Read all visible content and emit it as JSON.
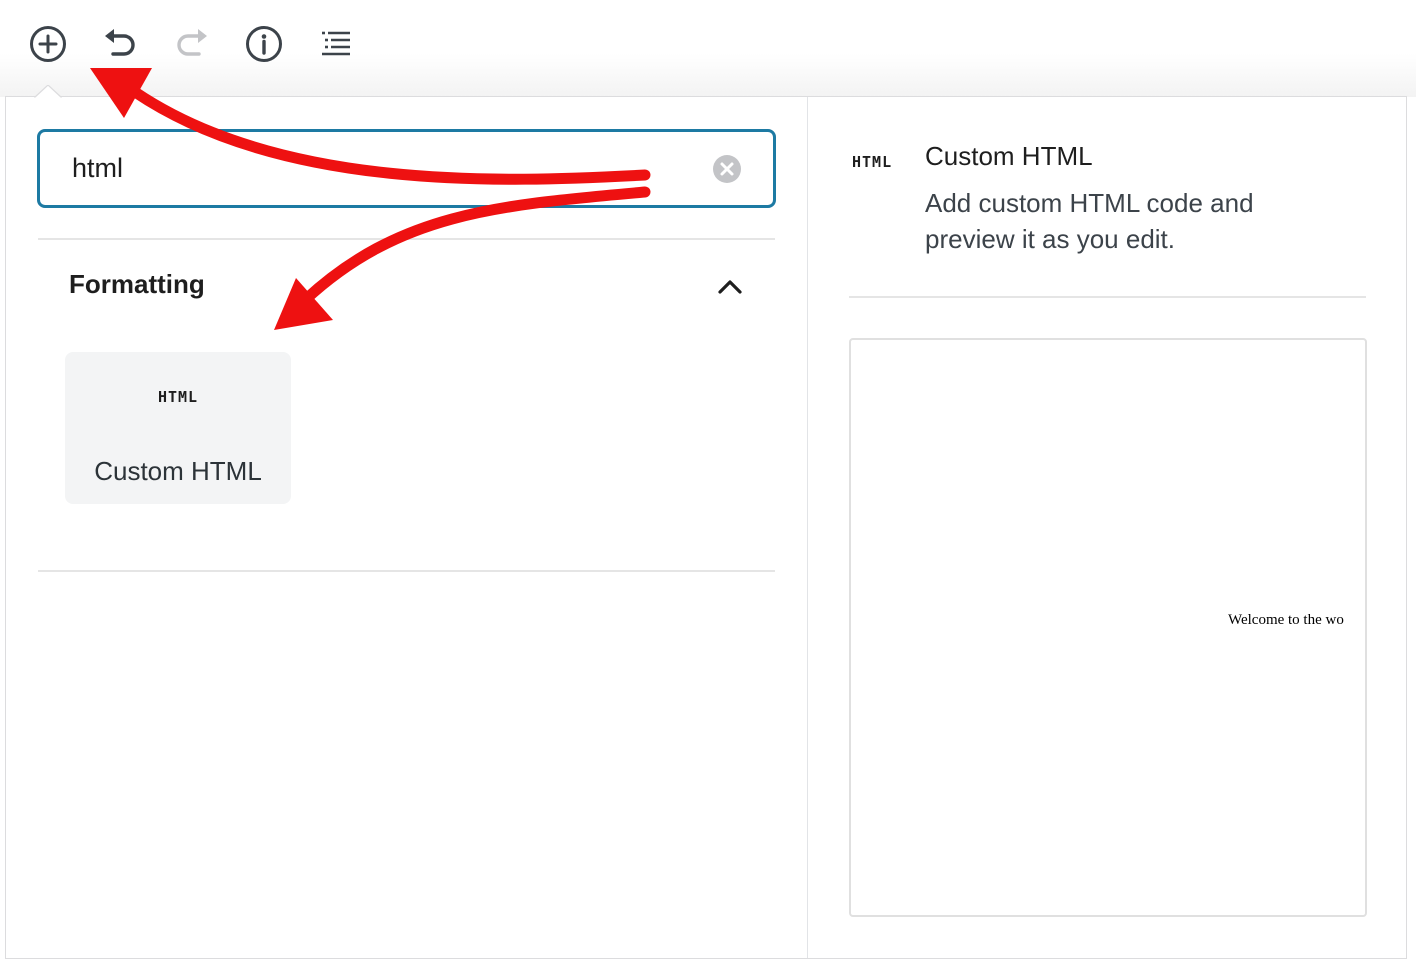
{
  "toolbar": {
    "buttons": [
      {
        "icon": "plus-circle-icon",
        "state": "active"
      },
      {
        "icon": "undo-icon",
        "state": "enabled"
      },
      {
        "icon": "redo-icon",
        "state": "disabled"
      },
      {
        "icon": "info-icon",
        "state": "enabled"
      },
      {
        "icon": "list-view-icon",
        "state": "enabled"
      }
    ]
  },
  "inserter": {
    "search": {
      "value": "html",
      "clear_icon": "clear-circle-icon"
    },
    "panel": {
      "title": "Formatting",
      "toggle_icon": "chevron-up-icon",
      "expanded": true,
      "blocks": [
        {
          "icon_text": "HTML",
          "label": "Custom HTML"
        }
      ]
    },
    "preview": {
      "icon_text": "HTML",
      "title": "Custom HTML",
      "description": "Add custom HTML code and preview it as you edit.",
      "sample_text": "Welcome to the wo"
    }
  },
  "annotations": {
    "arrow_color": "#ee1111",
    "arrows": 2
  },
  "colors": {
    "focus_border": "#1d7aa3",
    "icon_dark": "#3c434a",
    "icon_disabled": "#c3c4c7"
  }
}
